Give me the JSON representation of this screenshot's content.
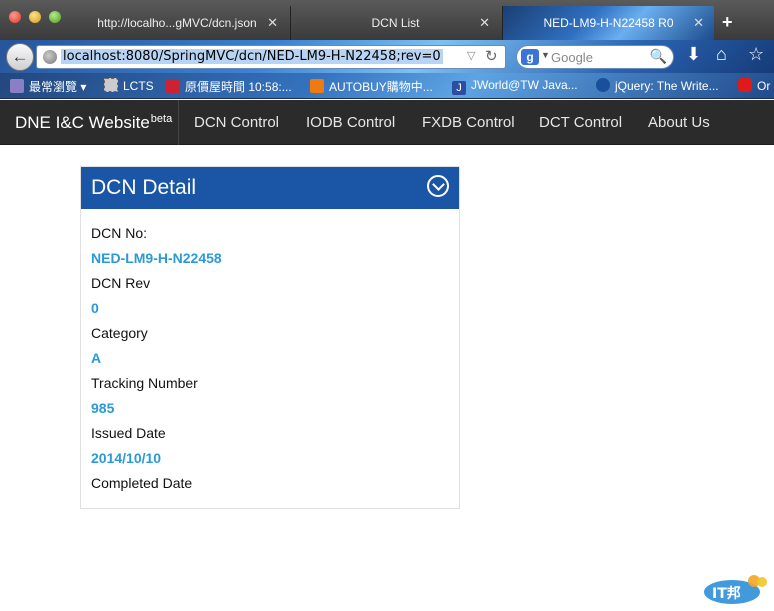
{
  "browser": {
    "tabs": [
      {
        "label": "http://localho...gMVC/dcn.json",
        "close": "✕"
      },
      {
        "label": "DCN List",
        "close": "✕"
      },
      {
        "label": "NED-LM9-H-N22458 R0",
        "close": "✕"
      }
    ],
    "new_tab": "+",
    "url": "localhost:8080/SpringMVC/dcn/NED-LM9-H-N22458;rev=0",
    "search_placeholder": "Google",
    "search_engine_badge": "g",
    "bookmarks": [
      {
        "label": "最常瀏覽",
        "icon": "folder-icon"
      },
      {
        "label": "LCTS",
        "icon": "page-icon"
      },
      {
        "label": "原價屋時間 10:58:...",
        "icon": "store-icon"
      },
      {
        "label": "AUTOBUY購物中...",
        "icon": "autobuy-icon"
      },
      {
        "label": "JWorld@TW Java...",
        "icon": "j-icon"
      },
      {
        "label": "jQuery: The Write...",
        "icon": "jquery-icon"
      },
      {
        "label": "Or",
        "icon": "oracle-icon"
      }
    ]
  },
  "site": {
    "brand": "DNE I&C Website",
    "brand_sup": "beta",
    "menu": [
      "DCN Control",
      "IODB Control",
      "FXDB Control",
      "DCT Control",
      "About Us"
    ]
  },
  "panel": {
    "title": "DCN Detail",
    "fields": [
      {
        "label": "DCN No:",
        "value": "NED-LM9-H-N22458"
      },
      {
        "label": "DCN Rev",
        "value": "0"
      },
      {
        "label": "Category",
        "value": "A"
      },
      {
        "label": "Tracking Number",
        "value": "985"
      },
      {
        "label": "Issued Date",
        "value": "2014/10/10"
      },
      {
        "label": "Completed Date",
        "value": ""
      }
    ]
  },
  "colors": {
    "panel_header": "#1a56a5",
    "value_text": "#2a9ad6",
    "site_nav_bg": "#2b2b2b"
  },
  "watermark": "IT邦幫忙"
}
